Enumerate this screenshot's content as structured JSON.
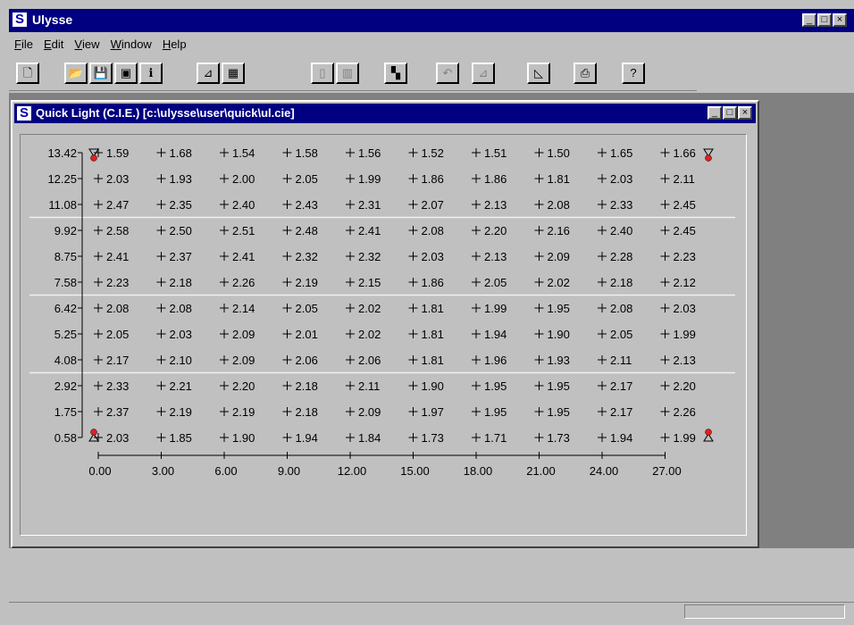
{
  "app": {
    "title": "Ulysse",
    "icon": "ulysse-s-icon"
  },
  "menu": [
    {
      "label": "File",
      "u": "F",
      "rest": "ile"
    },
    {
      "label": "Edit",
      "u": "E",
      "rest": "dit"
    },
    {
      "label": "View",
      "u": "V",
      "rest": "iew"
    },
    {
      "label": "Window",
      "u": "W",
      "rest": "indow"
    },
    {
      "label": "Help",
      "u": "H",
      "rest": "elp"
    }
  ],
  "toolbar": [
    {
      "name": "new-document-icon",
      "glyph": "🗋",
      "enabled": true
    },
    {
      "name": "open-folder-icon",
      "glyph": "📂",
      "enabled": true
    },
    {
      "name": "save-icon",
      "glyph": "💾",
      "enabled": true
    },
    {
      "name": "save-as-icon",
      "glyph": "▣",
      "enabled": true
    },
    {
      "name": "info-icon",
      "glyph": "ℹ",
      "enabled": true
    },
    {
      "name": "chart-icon",
      "glyph": "⊿",
      "enabled": true
    },
    {
      "name": "table-icon",
      "glyph": "▦",
      "enabled": true
    },
    {
      "name": "page-icon",
      "glyph": "▯",
      "enabled": false
    },
    {
      "name": "columns-icon",
      "glyph": "▥",
      "enabled": false
    },
    {
      "name": "render-icon",
      "glyph": "▚",
      "enabled": true
    },
    {
      "name": "undo-icon",
      "glyph": "↶",
      "enabled": false
    },
    {
      "name": "graph-disabled-icon",
      "glyph": "⊿",
      "enabled": false
    },
    {
      "name": "measure-icon",
      "glyph": "◺",
      "enabled": true
    },
    {
      "name": "print-icon",
      "glyph": "⎙",
      "enabled": true
    },
    {
      "name": "help-icon",
      "glyph": "?",
      "enabled": true
    }
  ],
  "window": {
    "title": "Quick Light (C.I.E.) [c:\\ulysse\\user\\quick\\ul.cie]"
  },
  "grid": {
    "y_labels": [
      "13.42",
      "12.25",
      "11.08",
      "9.92",
      "8.75",
      "7.58",
      "6.42",
      "5.25",
      "4.08",
      "2.92",
      "1.75",
      "0.58"
    ],
    "x_labels": [
      "0.00",
      "3.00",
      "6.00",
      "9.00",
      "12.00",
      "15.00",
      "18.00",
      "21.00",
      "24.00",
      "27.00"
    ],
    "rows": [
      [
        "1.59",
        "1.68",
        "1.54",
        "1.58",
        "1.56",
        "1.52",
        "1.51",
        "1.50",
        "1.65",
        "1.66"
      ],
      [
        "2.03",
        "1.93",
        "2.00",
        "2.05",
        "1.99",
        "1.86",
        "1.86",
        "1.81",
        "2.03",
        "2.11"
      ],
      [
        "2.47",
        "2.35",
        "2.40",
        "2.43",
        "2.31",
        "2.07",
        "2.13",
        "2.08",
        "2.33",
        "2.45"
      ],
      [
        "2.58",
        "2.50",
        "2.51",
        "2.48",
        "2.41",
        "2.08",
        "2.20",
        "2.16",
        "2.40",
        "2.45"
      ],
      [
        "2.41",
        "2.37",
        "2.41",
        "2.32",
        "2.32",
        "2.03",
        "2.13",
        "2.09",
        "2.28",
        "2.23"
      ],
      [
        "2.23",
        "2.18",
        "2.26",
        "2.19",
        "2.15",
        "1.86",
        "2.05",
        "2.02",
        "2.18",
        "2.12"
      ],
      [
        "2.08",
        "2.08",
        "2.14",
        "2.05",
        "2.02",
        "1.81",
        "1.99",
        "1.95",
        "2.08",
        "2.03"
      ],
      [
        "2.05",
        "2.03",
        "2.09",
        "2.01",
        "2.02",
        "1.81",
        "1.94",
        "1.90",
        "2.05",
        "1.99"
      ],
      [
        "2.17",
        "2.10",
        "2.09",
        "2.06",
        "2.06",
        "1.81",
        "1.96",
        "1.93",
        "2.11",
        "2.13"
      ],
      [
        "2.33",
        "2.21",
        "2.20",
        "2.18",
        "2.11",
        "1.90",
        "1.95",
        "1.95",
        "2.17",
        "2.20"
      ],
      [
        "2.37",
        "2.19",
        "2.19",
        "2.18",
        "2.09",
        "1.97",
        "1.95",
        "1.95",
        "2.17",
        "2.26"
      ],
      [
        "2.03",
        "1.85",
        "1.90",
        "1.94",
        "1.84",
        "1.73",
        "1.71",
        "1.73",
        "1.94",
        "1.99"
      ]
    ],
    "min": {
      "row": 0,
      "col": 1,
      "color": "#80e0e0"
    },
    "max": {
      "row": 3,
      "col": 0,
      "color": "#e02020"
    },
    "luminaire_color": "#e02020"
  }
}
